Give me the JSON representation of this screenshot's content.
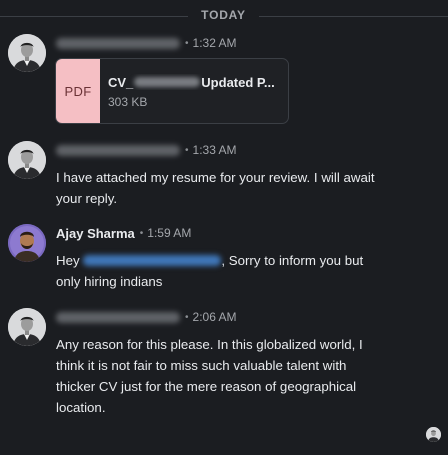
{
  "divider": {
    "label": "TODAY"
  },
  "messages": [
    {
      "sender": "",
      "time": "1:32 AM",
      "attachment": {
        "type_label": "PDF",
        "name_prefix": "CV_",
        "name_suffix": "Updated P...",
        "size": "303 KB"
      }
    },
    {
      "sender": "",
      "time": "1:33 AM",
      "text": "I have attached my resume for your review. I will await your reply."
    },
    {
      "sender": "Ajay Sharma",
      "time": "1:59 AM",
      "text_before_mention": "Hey ",
      "text_after_mention": ", Sorry to inform you but only hiring indians"
    },
    {
      "sender": "",
      "time": "2:06 AM",
      "text": "Any reason for this please. In this globalized world, I think it is not fair to miss such valuable talent with thicker CV just for the mere reason of geographical location."
    }
  ],
  "colors": {
    "background": "#1b1d21",
    "pdf_tile": "#f5bfc4",
    "mention": "#3f76b8"
  },
  "icons": [
    "profile-avatar",
    "pdf-file-icon",
    "seen-avatar"
  ]
}
